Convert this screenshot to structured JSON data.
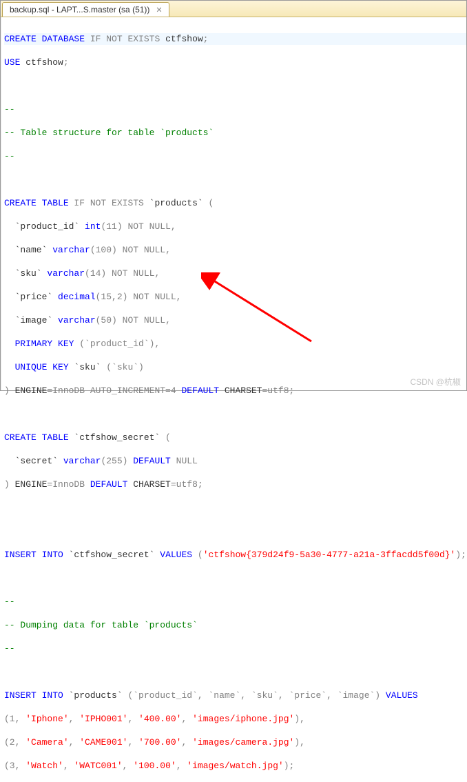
{
  "tab": {
    "title": "backup.sql - LAPT...S.master (sa (51))",
    "close": "✕"
  },
  "code": {
    "l1_create": "CREATE",
    "l1_database": " DATABASE ",
    "l1_if": "IF",
    "l1_not_exists": " NOT EXISTS ",
    "l1_db": "ctfshow",
    "l1_semi": ";",
    "l2_use": "USE ",
    "l2_db": "ctfshow",
    "l2_semi": ";",
    "c1": "--",
    "c2": "-- Table structure for table `products`",
    "c3": "--",
    "l3_create_table": "CREATE TABLE ",
    "l3_if": "IF",
    "l3_not_exists": " NOT EXISTS ",
    "l3_name": "`products`",
    "l3_open": " (",
    "l4_col": "  `product_id` ",
    "l4_type": "int",
    "l4_parens": "(11)",
    "l4_nn": " NOT NULL",
    "l4_comma": ",",
    "l5_col": "  `name` ",
    "l5_type": "varchar",
    "l5_parens": "(100)",
    "l5_nn": " NOT NULL",
    "l5_comma": ",",
    "l6_col": "  `sku` ",
    "l6_type": "varchar",
    "l6_parens": "(14)",
    "l6_nn": " NOT NULL",
    "l6_comma": ",",
    "l7_col": "  `price` ",
    "l7_type": "decimal",
    "l7_parens": "(15,2)",
    "l7_nn": " NOT NULL",
    "l7_comma": ",",
    "l8_col": "  `image` ",
    "l8_type": "varchar",
    "l8_parens": "(50)",
    "l8_nn": " NOT NULL",
    "l8_comma": ",",
    "l9_pk": "  PRIMARY KEY ",
    "l9_val": "(`product_id`)",
    "l9_comma": ",",
    "l10_uk": "  UNIQUE KEY ",
    "l10_name": "`sku` ",
    "l10_val": "(`sku`)",
    "l11_close": ") ",
    "l11_engine": "ENGINE",
    "l11_eq1": "=InnoDB AUTO_INCREMENT=4 ",
    "l11_default": "DEFAULT",
    "l11_charset": " CHARSET",
    "l11_eq2": "=utf8",
    "l11_semi": ";",
    "l12_create_table": "CREATE TABLE ",
    "l12_name": "`ctfshow_secret`",
    "l12_open": " (",
    "l13_col": "  `secret` ",
    "l13_type": "varchar",
    "l13_parens": "(255)",
    "l13_default": " DEFAULT",
    "l13_null": " NULL",
    "l14_close": ") ",
    "l14_engine": "ENGINE",
    "l14_eq1": "=InnoDB ",
    "l14_default": "DEFAULT",
    "l14_charset": " CHARSET",
    "l14_eq2": "=utf8",
    "l14_semi": ";",
    "l15_insert": "INSERT INTO",
    "l15_name": " `ctfshow_secret` ",
    "l15_values": "VALUES",
    "l15_open": " (",
    "l15_str": "'ctfshow{379d24f9-5a30-4777-a21a-3ffacdd5f00d}'",
    "l15_close": ")",
    "l15_semi": ";",
    "c4": "--",
    "c5": "-- Dumping data for table `products`",
    "c6": "--",
    "l16_insert": "INSERT INTO",
    "l16_name": " `products` ",
    "l16_open": "(`product_id`, `name`, `sku`, `price`, `image`) ",
    "l16_values": "VALUES",
    "r1_open": "(1, ",
    "r1_v1": "'Iphone'",
    "r1_c1": ", ",
    "r1_v2": "'IPHO001'",
    "r1_c2": ", ",
    "r1_v3": "'400.00'",
    "r1_c3": ", ",
    "r1_v4": "'images/iphone.jpg'",
    "r1_close": "),",
    "r2_open": "(2, ",
    "r2_v1": "'Camera'",
    "r2_c1": ", ",
    "r2_v2": "'CAME001'",
    "r2_c2": ", ",
    "r2_v3": "'700.00'",
    "r2_c3": ", ",
    "r2_v4": "'images/camera.jpg'",
    "r2_close": "),",
    "r3_open": "(3, ",
    "r3_v1": "'Watch'",
    "r3_c1": ", ",
    "r3_v2": "'WATC001'",
    "r3_c2": ", ",
    "r3_v3": "'100.00'",
    "r3_c3": ", ",
    "r3_v4": "'images/watch.jpg'",
    "r3_close": ");"
  },
  "watermark": "CSDN @杭椒"
}
